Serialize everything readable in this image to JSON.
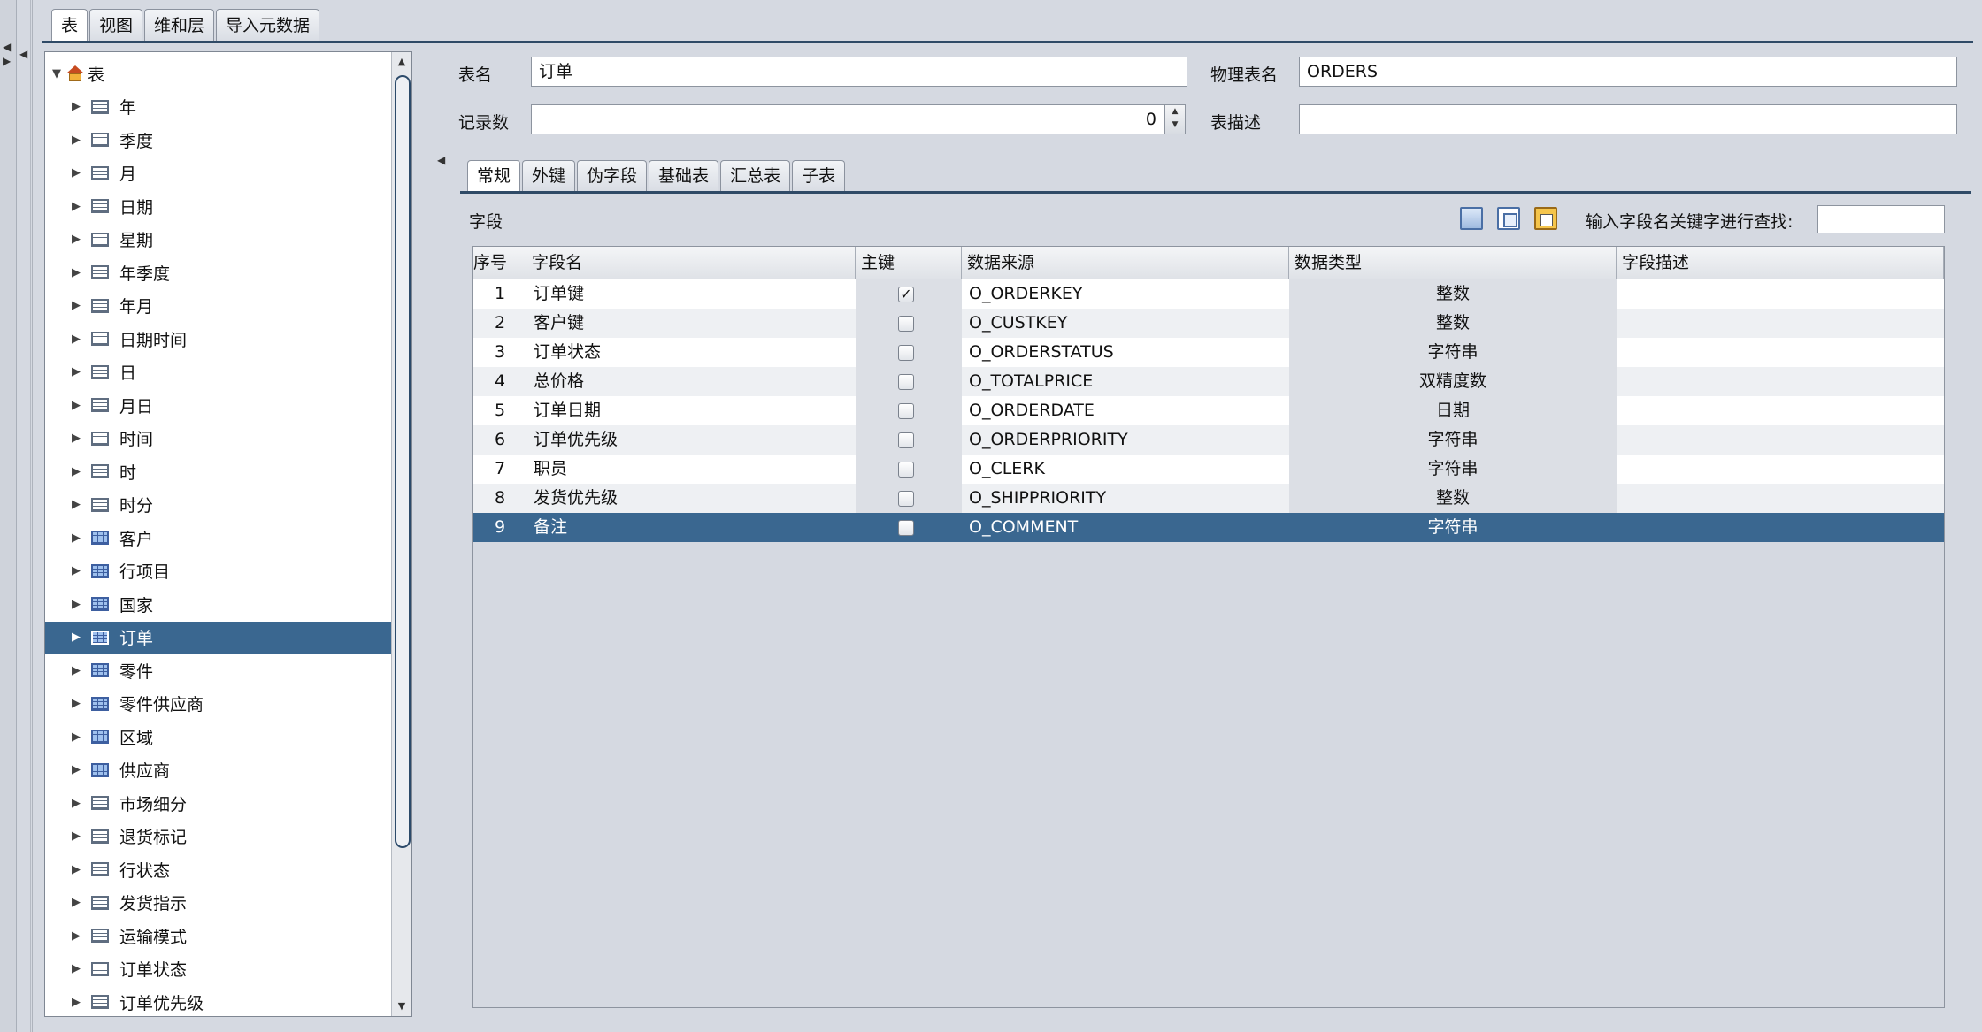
{
  "top_tabs": [
    "表",
    "视图",
    "维和层",
    "导入元数据"
  ],
  "tree": {
    "root_label": "表",
    "items": [
      {
        "label": "年",
        "kind": "dim"
      },
      {
        "label": "季度",
        "kind": "dim"
      },
      {
        "label": "月",
        "kind": "dim"
      },
      {
        "label": "日期",
        "kind": "dim"
      },
      {
        "label": "星期",
        "kind": "dim"
      },
      {
        "label": "年季度",
        "kind": "dim"
      },
      {
        "label": "年月",
        "kind": "dim"
      },
      {
        "label": "日期时间",
        "kind": "dim"
      },
      {
        "label": "日",
        "kind": "dim"
      },
      {
        "label": "月日",
        "kind": "dim"
      },
      {
        "label": "时间",
        "kind": "dim"
      },
      {
        "label": "时",
        "kind": "dim"
      },
      {
        "label": "时分",
        "kind": "dim"
      },
      {
        "label": "客户",
        "kind": "fact"
      },
      {
        "label": "行项目",
        "kind": "fact"
      },
      {
        "label": "国家",
        "kind": "fact"
      },
      {
        "label": "订单",
        "kind": "fact",
        "selected": true
      },
      {
        "label": "零件",
        "kind": "fact"
      },
      {
        "label": "零件供应商",
        "kind": "fact"
      },
      {
        "label": "区域",
        "kind": "fact"
      },
      {
        "label": "供应商",
        "kind": "fact"
      },
      {
        "label": "市场细分",
        "kind": "dim"
      },
      {
        "label": "退货标记",
        "kind": "dim"
      },
      {
        "label": "行状态",
        "kind": "dim"
      },
      {
        "label": "发货指示",
        "kind": "dim"
      },
      {
        "label": "运输模式",
        "kind": "dim"
      },
      {
        "label": "订单状态",
        "kind": "dim"
      },
      {
        "label": "订单优先级",
        "kind": "dim"
      }
    ]
  },
  "form": {
    "table_name_label": "表名",
    "table_name_value": "订单",
    "physical_name_label": "物理表名",
    "physical_name_value": "ORDERS",
    "record_count_label": "记录数",
    "record_count_value": "0",
    "description_label": "表描述",
    "description_value": ""
  },
  "inner_tabs": [
    "常规",
    "外键",
    "伪字段",
    "基础表",
    "汇总表",
    "子表"
  ],
  "fields_section": {
    "label": "字段",
    "search_label": "输入字段名关键字进行查找:",
    "search_value": ""
  },
  "table": {
    "headers": [
      "序号",
      "字段名",
      "主键",
      "数据来源",
      "数据类型",
      "字段描述"
    ],
    "rows": [
      {
        "no": "1",
        "name": "订单键",
        "pk": true,
        "source": "O_ORDERKEY",
        "type": "整数",
        "desc": ""
      },
      {
        "no": "2",
        "name": "客户键",
        "pk": false,
        "source": "O_CUSTKEY",
        "type": "整数",
        "desc": ""
      },
      {
        "no": "3",
        "name": "订单状态",
        "pk": false,
        "source": "O_ORDERSTATUS",
        "type": "字符串",
        "desc": ""
      },
      {
        "no": "4",
        "name": "总价格",
        "pk": false,
        "source": "O_TOTALPRICE",
        "type": "双精度数",
        "desc": ""
      },
      {
        "no": "5",
        "name": "订单日期",
        "pk": false,
        "source": "O_ORDERDATE",
        "type": "日期",
        "desc": ""
      },
      {
        "no": "6",
        "name": "订单优先级",
        "pk": false,
        "source": "O_ORDERPRIORITY",
        "type": "字符串",
        "desc": ""
      },
      {
        "no": "7",
        "name": "职员",
        "pk": false,
        "source": "O_CLERK",
        "type": "字符串",
        "desc": ""
      },
      {
        "no": "8",
        "name": "发货优先级",
        "pk": false,
        "source": "O_SHIPPRIORITY",
        "type": "整数",
        "desc": ""
      },
      {
        "no": "9",
        "name": "备注",
        "pk": false,
        "source": "O_COMMENT",
        "type": "字符串",
        "desc": "",
        "selected": true
      }
    ]
  }
}
